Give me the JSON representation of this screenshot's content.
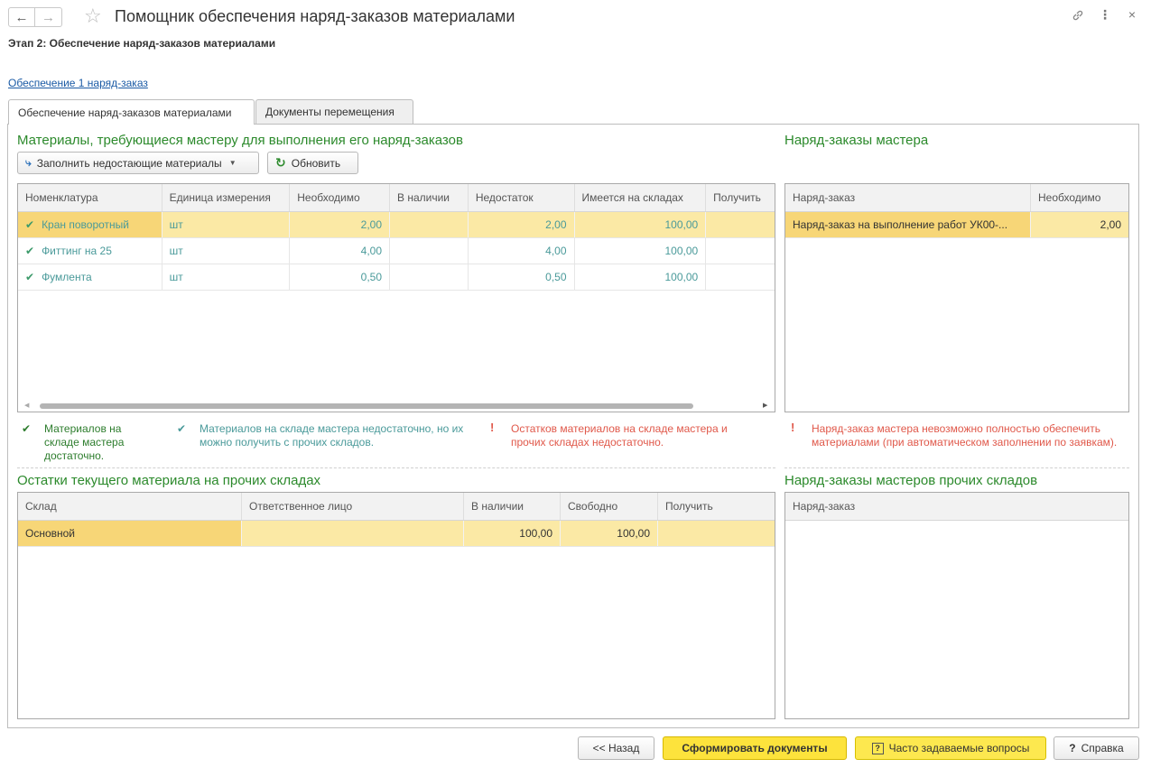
{
  "window": {
    "title": "Помощник обеспечения наряд-заказов материалами",
    "stage": "Этап 2: Обеспечение наряд-заказов материалами",
    "link": "Обеспечение 1 наряд-заказ"
  },
  "tabs": [
    {
      "label": "Обеспечение наряд-заказов материалами",
      "active": true
    },
    {
      "label": "Документы перемещения",
      "active": false
    }
  ],
  "materials": {
    "title": "Материалы, требующиеся мастеру для выполнения его наряд-заказов",
    "fill_button": "Заполнить недостающие материалы",
    "refresh_button": "Обновить",
    "columns": [
      "Номенклатура",
      "Единица измерения",
      "Необходимо",
      "В наличии",
      "Недостаток",
      "Имеется на складах",
      "Получить"
    ],
    "rows": [
      {
        "name": "Кран поворотный",
        "unit": "шт",
        "needed": "2,00",
        "available": "",
        "shortage": "2,00",
        "in_warehouses": "100,00",
        "receive": ""
      },
      {
        "name": "Фиттинг на 25",
        "unit": "шт",
        "needed": "4,00",
        "available": "",
        "shortage": "4,00",
        "in_warehouses": "100,00",
        "receive": ""
      },
      {
        "name": "Фумлента",
        "unit": "шт",
        "needed": "0,50",
        "available": "",
        "shortage": "0,50",
        "in_warehouses": "100,00",
        "receive": ""
      }
    ]
  },
  "master_orders": {
    "title": "Наряд-заказы мастера",
    "columns": [
      "Наряд-заказ",
      "Необходимо"
    ],
    "rows": [
      {
        "order": "Наряд-заказ на выполнение работ УК00-...",
        "needed": "2,00"
      }
    ]
  },
  "legend": {
    "enough": "Материалов на складе мастера достаточно.",
    "other_warehouses": "Материалов на складе мастера недостаточно, но их можно получить с прочих складов.",
    "insufficient": "Остатков материалов на складе мастера и прочих складах недостаточно.",
    "order_impossible": "Наряд-заказ мастера невозможно полностью обеспечить материалами (при автоматическом заполнении по заявкам)."
  },
  "remains": {
    "title": "Остатки текущего материала на прочих складах",
    "columns": [
      "Склад",
      "Ответственное лицо",
      "В наличии",
      "Свободно",
      "Получить"
    ],
    "rows": [
      {
        "warehouse": "Основной",
        "responsible": "",
        "available": "100,00",
        "free": "100,00",
        "receive": ""
      }
    ]
  },
  "other_orders": {
    "title": "Наряд-заказы мастеров прочих складов",
    "columns": [
      "Наряд-заказ"
    ]
  },
  "footer": {
    "back": "<< Назад",
    "generate": "Сформировать документы",
    "faq": "Часто задаваемые вопросы",
    "help": "Справка"
  },
  "colors": {
    "section_title": "#2c8a2c",
    "selected_row": "#fbe9a5",
    "primary_button": "#fde33c",
    "error": "#e0584a"
  }
}
